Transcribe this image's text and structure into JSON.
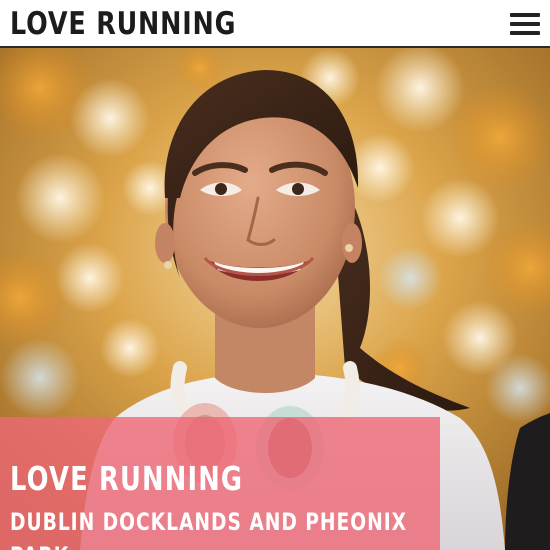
{
  "header": {
    "brand": "LOVE RUNNING",
    "menu_icon": "hamburger-menu-icon"
  },
  "hero": {
    "image_subject": "smiling-woman-runner-autumn-trees",
    "title": "LOVE RUNNING",
    "subtitle": "DUBLIN DOCKLANDS AND PHEONIX PARK",
    "overlay_color": "#ee6876"
  },
  "colors": {
    "header_text": "#1c1c1c",
    "overlay_text": "#ffffff",
    "autumn_leaves": "#e0a33a"
  }
}
